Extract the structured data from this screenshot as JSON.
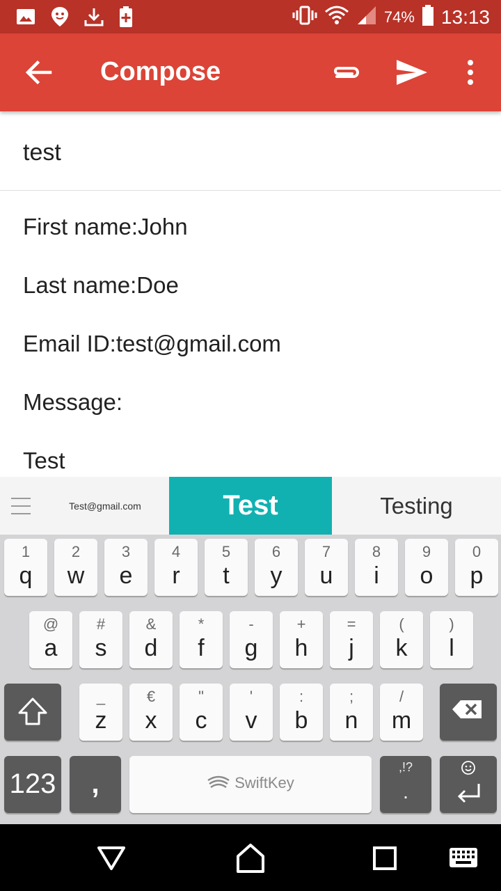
{
  "status_bar": {
    "battery_percent": "74%",
    "time": "13:13",
    "left_icons": [
      "image-icon",
      "location-icon",
      "download-icon",
      "battery-saver-icon"
    ],
    "right_icons": [
      "vibrate-icon",
      "wifi-icon",
      "signal-icon",
      "battery-icon"
    ]
  },
  "app_bar": {
    "title": "Compose",
    "color": "#db4437"
  },
  "compose": {
    "subject": "test",
    "body_lines": [
      "First name:John",
      "Last name:Doe",
      "Email ID:test@gmail.com",
      "Message:",
      "Test"
    ]
  },
  "suggestions": {
    "left": "Test@gmail.com",
    "middle": "Test",
    "right": "Testing",
    "accent": "#11b1b1"
  },
  "keyboard": {
    "brand": "SwiftKey",
    "row1": [
      {
        "hint": "1",
        "key": "q"
      },
      {
        "hint": "2",
        "key": "w"
      },
      {
        "hint": "3",
        "key": "e"
      },
      {
        "hint": "4",
        "key": "r"
      },
      {
        "hint": "5",
        "key": "t"
      },
      {
        "hint": "6",
        "key": "y"
      },
      {
        "hint": "7",
        "key": "u"
      },
      {
        "hint": "8",
        "key": "i"
      },
      {
        "hint": "9",
        "key": "o"
      },
      {
        "hint": "0",
        "key": "p"
      }
    ],
    "row2": [
      {
        "hint": "@",
        "key": "a"
      },
      {
        "hint": "#",
        "key": "s"
      },
      {
        "hint": "&",
        "key": "d"
      },
      {
        "hint": "*",
        "key": "f"
      },
      {
        "hint": "-",
        "key": "g"
      },
      {
        "hint": "+",
        "key": "h"
      },
      {
        "hint": "=",
        "key": "j"
      },
      {
        "hint": "(",
        "key": "k"
      },
      {
        "hint": ")",
        "key": "l"
      }
    ],
    "row3": [
      {
        "hint": "_",
        "key": "z"
      },
      {
        "hint": "€",
        "key": "x"
      },
      {
        "hint": "\"",
        "key": "c"
      },
      {
        "hint": "'",
        "key": "v"
      },
      {
        "hint": ":",
        "key": "b"
      },
      {
        "hint": ";",
        "key": "n"
      },
      {
        "hint": "/",
        "key": "m"
      }
    ],
    "numbers_key": "123",
    "comma_key": ",",
    "period_hint": ",!?",
    "period_key": "."
  }
}
